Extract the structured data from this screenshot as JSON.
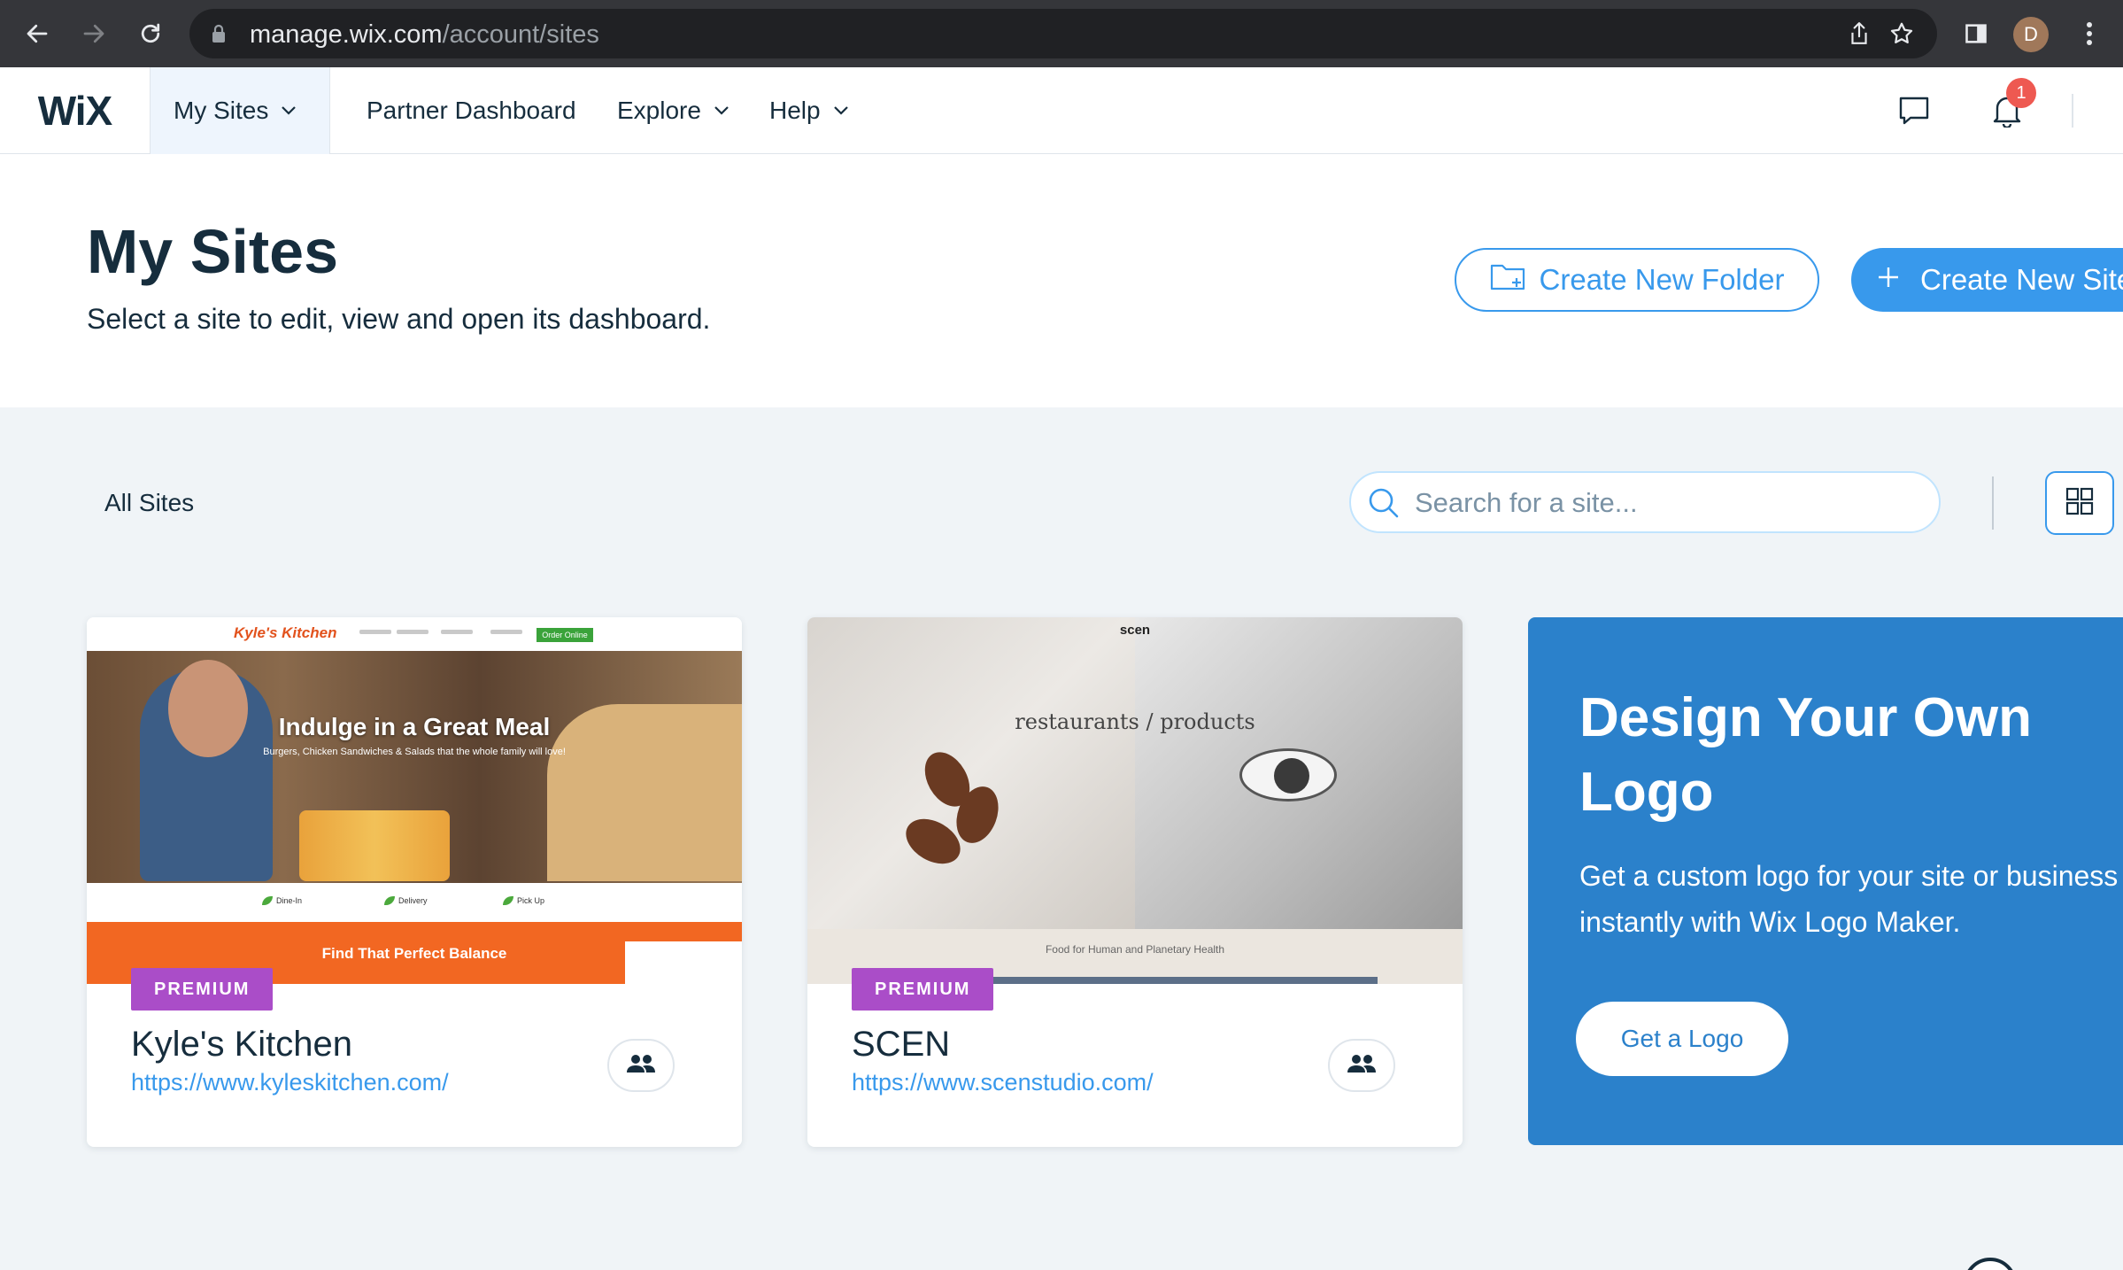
{
  "browser": {
    "url_host": "manage.wix.com",
    "url_path": "/account/sites",
    "profile_initial": "D"
  },
  "nav": {
    "logo": "WiX",
    "my_sites": "My Sites",
    "partner_dashboard": "Partner Dashboard",
    "explore": "Explore",
    "help": "Help",
    "notification_count": "1"
  },
  "header": {
    "title": "My Sites",
    "subtitle": "Select a site to edit, view and open its dashboard.",
    "create_folder": "Create New Folder",
    "create_site": "Create New Site"
  },
  "toolbar": {
    "filter_label": "All Sites",
    "search_placeholder": "Search for a site..."
  },
  "sites": [
    {
      "badge": "PREMIUM",
      "name": "Kyle's Kitchen",
      "url": "https://www.kyleskitchen.com/",
      "preview": {
        "brand": "Kyle's Kitchen",
        "order_btn": "Order Online",
        "headline": "Indulge in a Great Meal",
        "sub": "Burgers, Chicken Sandwiches & Salads that the whole family will love!",
        "icons": [
          "Dine-In",
          "Delivery",
          "Pick Up"
        ],
        "banner": "Find That Perfect Balance"
      }
    },
    {
      "badge": "PREMIUM",
      "name": "SCEN",
      "url": "https://www.scenstudio.com/",
      "preview": {
        "brand": "scen",
        "headline": "restaurants / products",
        "strip": "Food for Human and Planetary Health"
      }
    }
  ],
  "promo": {
    "title": "Design Your Own Logo",
    "text": "Get a custom logo for your site or business instantly with Wix Logo Maker.",
    "button": "Get a Logo"
  },
  "colors": {
    "accent": "#3899ec",
    "premium": "#aa4dc8",
    "promo_bg": "#2b81cb",
    "text": "#162d3d"
  }
}
